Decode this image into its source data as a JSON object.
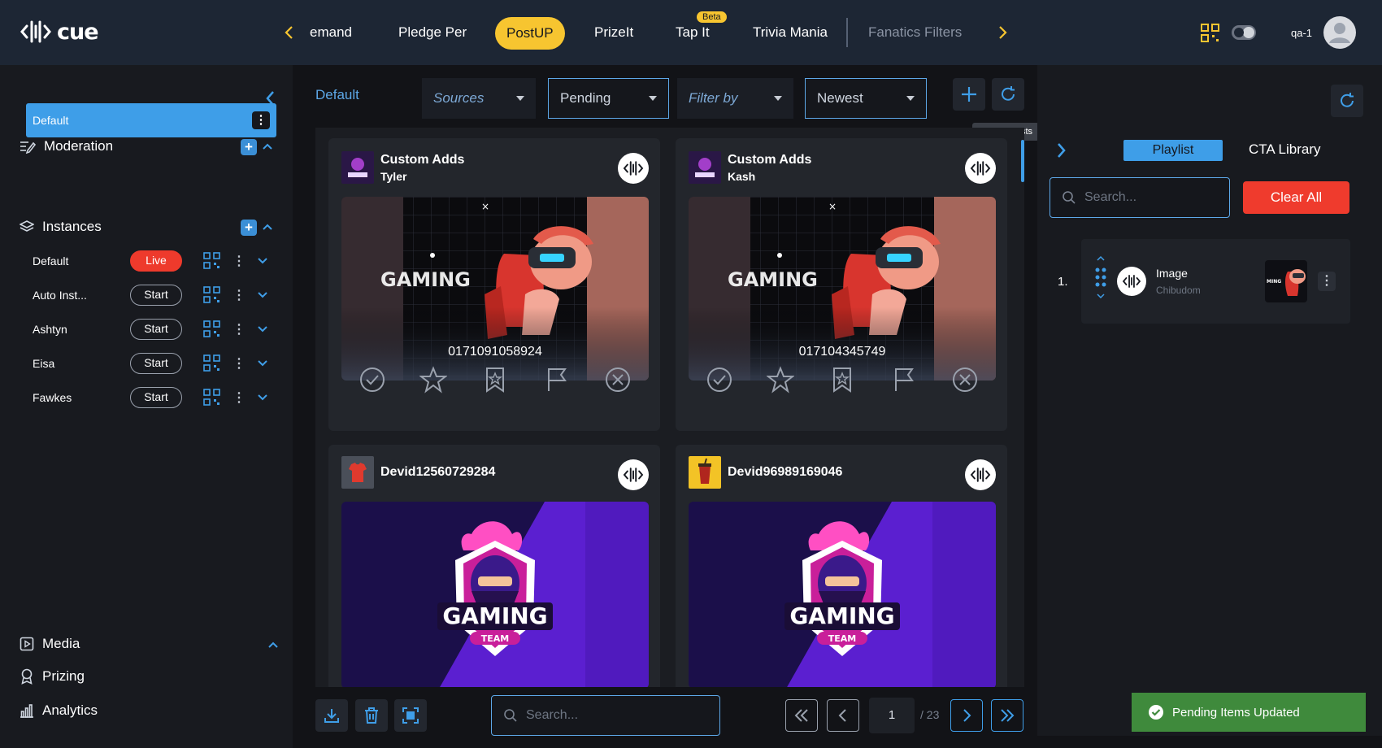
{
  "app": {
    "logo_text": "cue",
    "user": "qa-1"
  },
  "nav": {
    "items": [
      {
        "label": "Demand",
        "display": "emand"
      },
      {
        "label": "Pledge Per"
      },
      {
        "label": "PostUP"
      },
      {
        "label": "PrizeIt"
      },
      {
        "label": "Tap It"
      },
      {
        "label": "Trivia Mania"
      },
      {
        "label": "Fanatics Filters"
      }
    ],
    "badge": "Beta",
    "active_label": "PostUP",
    "active_color": "#f7c530"
  },
  "sidebar": {
    "moderation": {
      "label": "Moderation",
      "items": [
        {
          "label": "Default"
        }
      ]
    },
    "instances": {
      "label": "Instances",
      "items": [
        {
          "name": "Default",
          "status": "Live"
        },
        {
          "name": "Auto Inst...",
          "status": "Start"
        },
        {
          "name": "Ashtyn",
          "status": "Start"
        },
        {
          "name": "Eisa",
          "status": "Start"
        },
        {
          "name": "Fawkes",
          "status": "Start"
        }
      ]
    },
    "bottom": [
      {
        "label": "Media"
      },
      {
        "label": "Prizing"
      },
      {
        "label": "Analytics"
      }
    ]
  },
  "main": {
    "breadcrumb": "Default",
    "filters": {
      "sources": "Sources",
      "status": "Pending",
      "filter_by": "Filter by",
      "sort": "Newest"
    },
    "tooltip": "Update Posts",
    "cards": [
      {
        "title": "Custom Adds",
        "subtitle": "Tyler",
        "image_text": "0171091058924"
      },
      {
        "title": "Custom Adds",
        "subtitle": "Kash",
        "image_text": "017104345749"
      },
      {
        "title": "Devid12560729284",
        "subtitle": ""
      },
      {
        "title": "Devid96989169046",
        "subtitle": ""
      }
    ],
    "gaming_title": "GAMING",
    "gaming_sub": "TEAM",
    "search_placeholder": "Search...",
    "pagination": {
      "current": "1",
      "total": "/ 23"
    }
  },
  "right_panel": {
    "tabs": {
      "playlist": "Playlist",
      "cta": "CTA Library"
    },
    "search_placeholder": "Search...",
    "clear_all": "Clear All",
    "playlist": [
      {
        "index": "1.",
        "title": "Image",
        "subtitle": "Chibudom"
      }
    ]
  },
  "toast": {
    "text": "Pending Items Updated",
    "color": "#3f8a3c"
  }
}
